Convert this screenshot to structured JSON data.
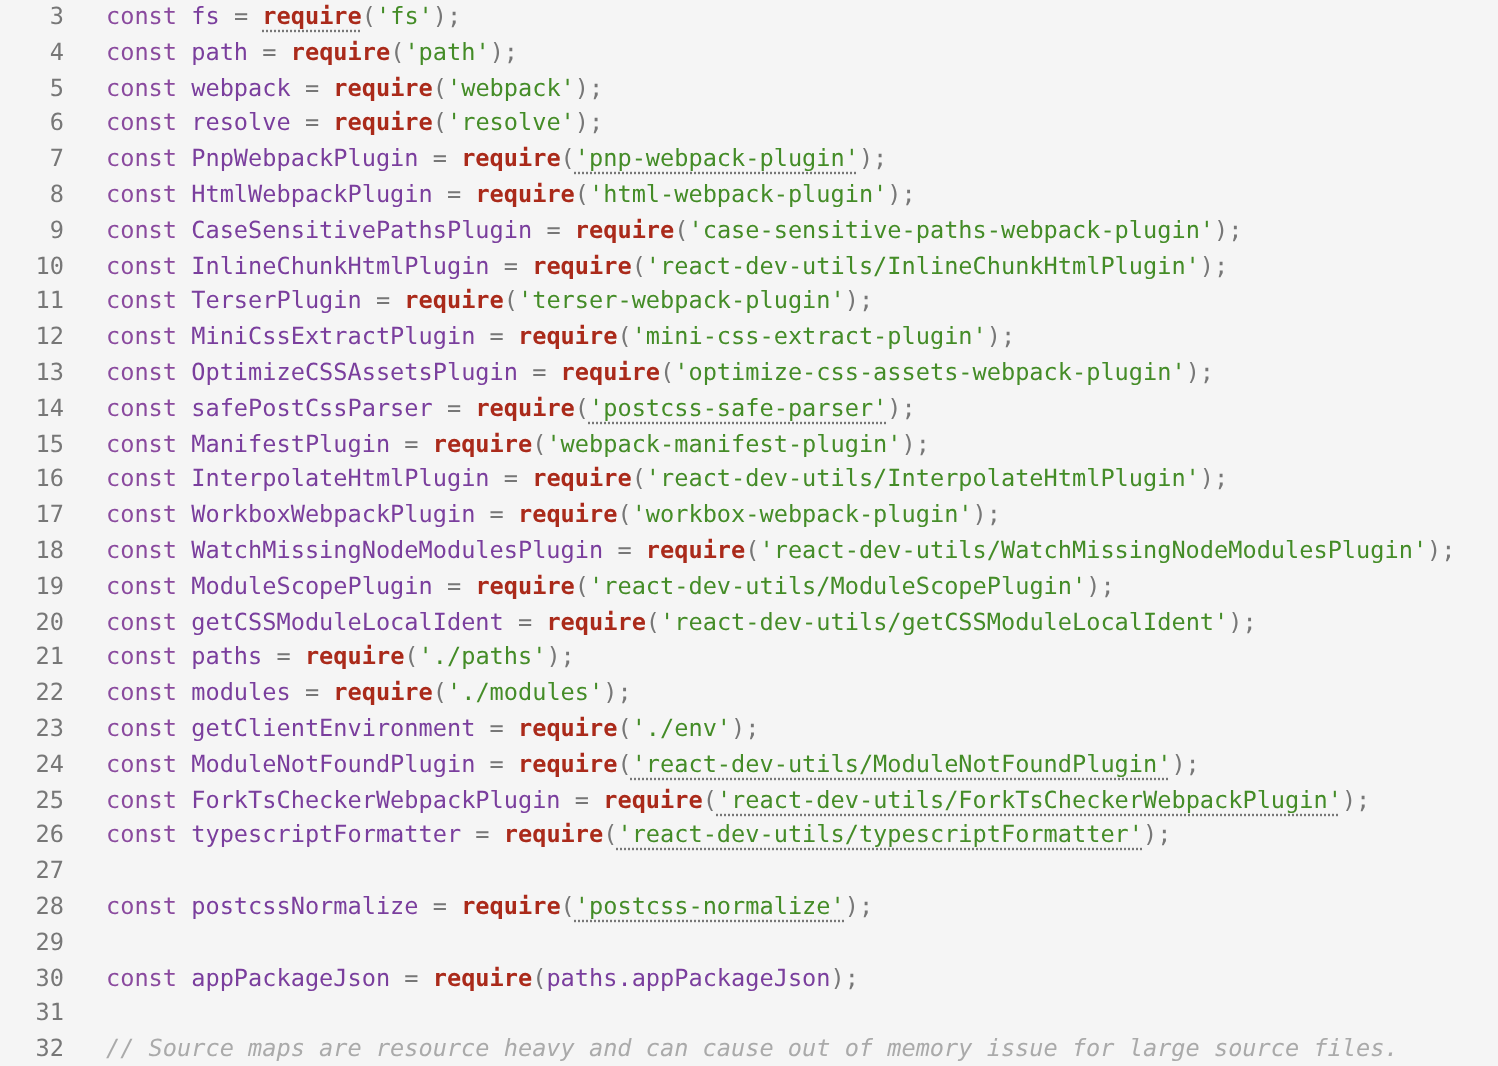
{
  "editor": {
    "lines": [
      {
        "number": "3",
        "tokens": [
          {
            "kind": "keyword",
            "text": "const "
          },
          {
            "kind": "variable",
            "text": "fs"
          },
          {
            "kind": "punct",
            "text": " = "
          },
          {
            "kind": "call",
            "text": "require",
            "flagged": true
          },
          {
            "kind": "punct",
            "text": "("
          },
          {
            "kind": "string",
            "text": "'fs'"
          },
          {
            "kind": "punct",
            "text": ");"
          }
        ]
      },
      {
        "number": "4",
        "tokens": [
          {
            "kind": "keyword",
            "text": "const "
          },
          {
            "kind": "variable",
            "text": "path"
          },
          {
            "kind": "punct",
            "text": " = "
          },
          {
            "kind": "call",
            "text": "require"
          },
          {
            "kind": "punct",
            "text": "("
          },
          {
            "kind": "string",
            "text": "'path'"
          },
          {
            "kind": "punct",
            "text": ");"
          }
        ]
      },
      {
        "number": "5",
        "tokens": [
          {
            "kind": "keyword",
            "text": "const "
          },
          {
            "kind": "variable",
            "text": "webpack"
          },
          {
            "kind": "punct",
            "text": " = "
          },
          {
            "kind": "call",
            "text": "require"
          },
          {
            "kind": "punct",
            "text": "("
          },
          {
            "kind": "string",
            "text": "'webpack'"
          },
          {
            "kind": "punct",
            "text": ");"
          }
        ]
      },
      {
        "number": "6",
        "tokens": [
          {
            "kind": "keyword",
            "text": "const "
          },
          {
            "kind": "variable",
            "text": "resolve"
          },
          {
            "kind": "punct",
            "text": " = "
          },
          {
            "kind": "call",
            "text": "require"
          },
          {
            "kind": "punct",
            "text": "("
          },
          {
            "kind": "string",
            "text": "'resolve'"
          },
          {
            "kind": "punct",
            "text": ");"
          }
        ]
      },
      {
        "number": "7",
        "tokens": [
          {
            "kind": "keyword",
            "text": "const "
          },
          {
            "kind": "variable",
            "text": "PnpWebpackPlugin"
          },
          {
            "kind": "punct",
            "text": " = "
          },
          {
            "kind": "call",
            "text": "require"
          },
          {
            "kind": "punct",
            "text": "("
          },
          {
            "kind": "string",
            "text": "'pnp-webpack-plugin'",
            "flagged": true
          },
          {
            "kind": "punct",
            "text": ");"
          }
        ]
      },
      {
        "number": "8",
        "tokens": [
          {
            "kind": "keyword",
            "text": "const "
          },
          {
            "kind": "variable",
            "text": "HtmlWebpackPlugin"
          },
          {
            "kind": "punct",
            "text": " = "
          },
          {
            "kind": "call",
            "text": "require"
          },
          {
            "kind": "punct",
            "text": "("
          },
          {
            "kind": "string",
            "text": "'html-webpack-plugin'"
          },
          {
            "kind": "punct",
            "text": ");"
          }
        ]
      },
      {
        "number": "9",
        "tokens": [
          {
            "kind": "keyword",
            "text": "const "
          },
          {
            "kind": "variable",
            "text": "CaseSensitivePathsPlugin"
          },
          {
            "kind": "punct",
            "text": " = "
          },
          {
            "kind": "call",
            "text": "require"
          },
          {
            "kind": "punct",
            "text": "("
          },
          {
            "kind": "string",
            "text": "'case-sensitive-paths-webpack-plugin'"
          },
          {
            "kind": "punct",
            "text": ");"
          }
        ]
      },
      {
        "number": "10",
        "tokens": [
          {
            "kind": "keyword",
            "text": "const "
          },
          {
            "kind": "variable",
            "text": "InlineChunkHtmlPlugin"
          },
          {
            "kind": "punct",
            "text": " = "
          },
          {
            "kind": "call",
            "text": "require"
          },
          {
            "kind": "punct",
            "text": "("
          },
          {
            "kind": "string",
            "text": "'react-dev-utils/InlineChunkHtmlPlugin'"
          },
          {
            "kind": "punct",
            "text": ");"
          }
        ]
      },
      {
        "number": "11",
        "tokens": [
          {
            "kind": "keyword",
            "text": "const "
          },
          {
            "kind": "variable",
            "text": "TerserPlugin"
          },
          {
            "kind": "punct",
            "text": " = "
          },
          {
            "kind": "call",
            "text": "require"
          },
          {
            "kind": "punct",
            "text": "("
          },
          {
            "kind": "string",
            "text": "'terser-webpack-plugin'"
          },
          {
            "kind": "punct",
            "text": ");"
          }
        ]
      },
      {
        "number": "12",
        "tokens": [
          {
            "kind": "keyword",
            "text": "const "
          },
          {
            "kind": "variable",
            "text": "MiniCssExtractPlugin"
          },
          {
            "kind": "punct",
            "text": " = "
          },
          {
            "kind": "call",
            "text": "require"
          },
          {
            "kind": "punct",
            "text": "("
          },
          {
            "kind": "string",
            "text": "'mini-css-extract-plugin'"
          },
          {
            "kind": "punct",
            "text": ");"
          }
        ]
      },
      {
        "number": "13",
        "tokens": [
          {
            "kind": "keyword",
            "text": "const "
          },
          {
            "kind": "variable",
            "text": "OptimizeCSSAssetsPlugin"
          },
          {
            "kind": "punct",
            "text": " = "
          },
          {
            "kind": "call",
            "text": "require"
          },
          {
            "kind": "punct",
            "text": "("
          },
          {
            "kind": "string",
            "text": "'optimize-css-assets-webpack-plugin'"
          },
          {
            "kind": "punct",
            "text": ");"
          }
        ]
      },
      {
        "number": "14",
        "tokens": [
          {
            "kind": "keyword",
            "text": "const "
          },
          {
            "kind": "variable",
            "text": "safePostCssParser"
          },
          {
            "kind": "punct",
            "text": " = "
          },
          {
            "kind": "call",
            "text": "require"
          },
          {
            "kind": "punct",
            "text": "("
          },
          {
            "kind": "string",
            "text": "'postcss-safe-parser'",
            "flagged": true
          },
          {
            "kind": "punct",
            "text": ");"
          }
        ]
      },
      {
        "number": "15",
        "tokens": [
          {
            "kind": "keyword",
            "text": "const "
          },
          {
            "kind": "variable",
            "text": "ManifestPlugin"
          },
          {
            "kind": "punct",
            "text": " = "
          },
          {
            "kind": "call",
            "text": "require"
          },
          {
            "kind": "punct",
            "text": "("
          },
          {
            "kind": "string",
            "text": "'webpack-manifest-plugin'"
          },
          {
            "kind": "punct",
            "text": ");"
          }
        ]
      },
      {
        "number": "16",
        "tokens": [
          {
            "kind": "keyword",
            "text": "const "
          },
          {
            "kind": "variable",
            "text": "InterpolateHtmlPlugin"
          },
          {
            "kind": "punct",
            "text": " = "
          },
          {
            "kind": "call",
            "text": "require"
          },
          {
            "kind": "punct",
            "text": "("
          },
          {
            "kind": "string",
            "text": "'react-dev-utils/InterpolateHtmlPlugin'"
          },
          {
            "kind": "punct",
            "text": ");"
          }
        ]
      },
      {
        "number": "17",
        "tokens": [
          {
            "kind": "keyword",
            "text": "const "
          },
          {
            "kind": "variable",
            "text": "WorkboxWebpackPlugin"
          },
          {
            "kind": "punct",
            "text": " = "
          },
          {
            "kind": "call",
            "text": "require"
          },
          {
            "kind": "punct",
            "text": "("
          },
          {
            "kind": "string",
            "text": "'workbox-webpack-plugin'"
          },
          {
            "kind": "punct",
            "text": ");"
          }
        ]
      },
      {
        "number": "18",
        "tokens": [
          {
            "kind": "keyword",
            "text": "const "
          },
          {
            "kind": "variable",
            "text": "WatchMissingNodeModulesPlugin"
          },
          {
            "kind": "punct",
            "text": " = "
          },
          {
            "kind": "call",
            "text": "require"
          },
          {
            "kind": "punct",
            "text": "("
          },
          {
            "kind": "string",
            "text": "'react-dev-utils/WatchMissingNodeModulesPlugin'"
          },
          {
            "kind": "punct",
            "text": ");"
          }
        ]
      },
      {
        "number": "19",
        "tokens": [
          {
            "kind": "keyword",
            "text": "const "
          },
          {
            "kind": "variable",
            "text": "ModuleScopePlugin"
          },
          {
            "kind": "punct",
            "text": " = "
          },
          {
            "kind": "call",
            "text": "require"
          },
          {
            "kind": "punct",
            "text": "("
          },
          {
            "kind": "string",
            "text": "'react-dev-utils/ModuleScopePlugin'"
          },
          {
            "kind": "punct",
            "text": ");"
          }
        ]
      },
      {
        "number": "20",
        "tokens": [
          {
            "kind": "keyword",
            "text": "const "
          },
          {
            "kind": "variable",
            "text": "getCSSModuleLocalIdent"
          },
          {
            "kind": "punct",
            "text": " = "
          },
          {
            "kind": "call",
            "text": "require"
          },
          {
            "kind": "punct",
            "text": "("
          },
          {
            "kind": "string",
            "text": "'react-dev-utils/getCSSModuleLocalIdent'"
          },
          {
            "kind": "punct",
            "text": ");"
          }
        ]
      },
      {
        "number": "21",
        "tokens": [
          {
            "kind": "keyword",
            "text": "const "
          },
          {
            "kind": "variable",
            "text": "paths"
          },
          {
            "kind": "punct",
            "text": " = "
          },
          {
            "kind": "call",
            "text": "require"
          },
          {
            "kind": "punct",
            "text": "("
          },
          {
            "kind": "string",
            "text": "'./paths'"
          },
          {
            "kind": "punct",
            "text": ");"
          }
        ]
      },
      {
        "number": "22",
        "tokens": [
          {
            "kind": "keyword",
            "text": "const "
          },
          {
            "kind": "variable",
            "text": "modules"
          },
          {
            "kind": "punct",
            "text": " = "
          },
          {
            "kind": "call",
            "text": "require"
          },
          {
            "kind": "punct",
            "text": "("
          },
          {
            "kind": "string",
            "text": "'./modules'"
          },
          {
            "kind": "punct",
            "text": ");"
          }
        ]
      },
      {
        "number": "23",
        "tokens": [
          {
            "kind": "keyword",
            "text": "const "
          },
          {
            "kind": "variable",
            "text": "getClientEnvironment"
          },
          {
            "kind": "punct",
            "text": " = "
          },
          {
            "kind": "call",
            "text": "require"
          },
          {
            "kind": "punct",
            "text": "("
          },
          {
            "kind": "string",
            "text": "'./env'"
          },
          {
            "kind": "punct",
            "text": ");"
          }
        ]
      },
      {
        "number": "24",
        "tokens": [
          {
            "kind": "keyword",
            "text": "const "
          },
          {
            "kind": "variable",
            "text": "ModuleNotFoundPlugin"
          },
          {
            "kind": "punct",
            "text": " = "
          },
          {
            "kind": "call",
            "text": "require"
          },
          {
            "kind": "punct",
            "text": "("
          },
          {
            "kind": "string",
            "text": "'react-dev-utils/ModuleNotFoundPlugin'",
            "flagged": true
          },
          {
            "kind": "punct",
            "text": ");"
          }
        ]
      },
      {
        "number": "25",
        "tokens": [
          {
            "kind": "keyword",
            "text": "const "
          },
          {
            "kind": "variable",
            "text": "ForkTsCheckerWebpackPlugin"
          },
          {
            "kind": "punct",
            "text": " = "
          },
          {
            "kind": "call",
            "text": "require"
          },
          {
            "kind": "punct",
            "text": "("
          },
          {
            "kind": "string",
            "text": "'react-dev-utils/ForkTsCheckerWebpackPlugin'",
            "flagged": true
          },
          {
            "kind": "punct",
            "text": ");"
          }
        ]
      },
      {
        "number": "26",
        "tokens": [
          {
            "kind": "keyword",
            "text": "const "
          },
          {
            "kind": "variable",
            "text": "typescriptFormatter"
          },
          {
            "kind": "punct",
            "text": " = "
          },
          {
            "kind": "call",
            "text": "require"
          },
          {
            "kind": "punct",
            "text": "("
          },
          {
            "kind": "string",
            "text": "'react-dev-utils/typescriptFormatter'",
            "flagged": true
          },
          {
            "kind": "punct",
            "text": ");"
          }
        ]
      },
      {
        "number": "27"
      },
      {
        "number": "28",
        "tokens": [
          {
            "kind": "keyword",
            "text": "const "
          },
          {
            "kind": "variable",
            "text": "postcssNormalize"
          },
          {
            "kind": "punct",
            "text": " = "
          },
          {
            "kind": "call",
            "text": "require"
          },
          {
            "kind": "punct",
            "text": "("
          },
          {
            "kind": "string",
            "text": "'postcss-normalize'",
            "flagged": true
          },
          {
            "kind": "punct",
            "text": ");"
          }
        ]
      },
      {
        "number": "29"
      },
      {
        "number": "30",
        "tokens": [
          {
            "kind": "keyword",
            "text": "const "
          },
          {
            "kind": "variable",
            "text": "appPackageJson"
          },
          {
            "kind": "punct",
            "text": " = "
          },
          {
            "kind": "call",
            "text": "require"
          },
          {
            "kind": "punct",
            "text": "("
          },
          {
            "kind": "variable",
            "text": "paths.appPackageJson"
          },
          {
            "kind": "punct",
            "text": ");"
          }
        ]
      },
      {
        "number": "31"
      },
      {
        "number": "32",
        "tokens": [
          {
            "kind": "comment",
            "text": "// Source maps are resource heavy and can cause out of memory issue for large source files."
          }
        ]
      }
    ]
  }
}
